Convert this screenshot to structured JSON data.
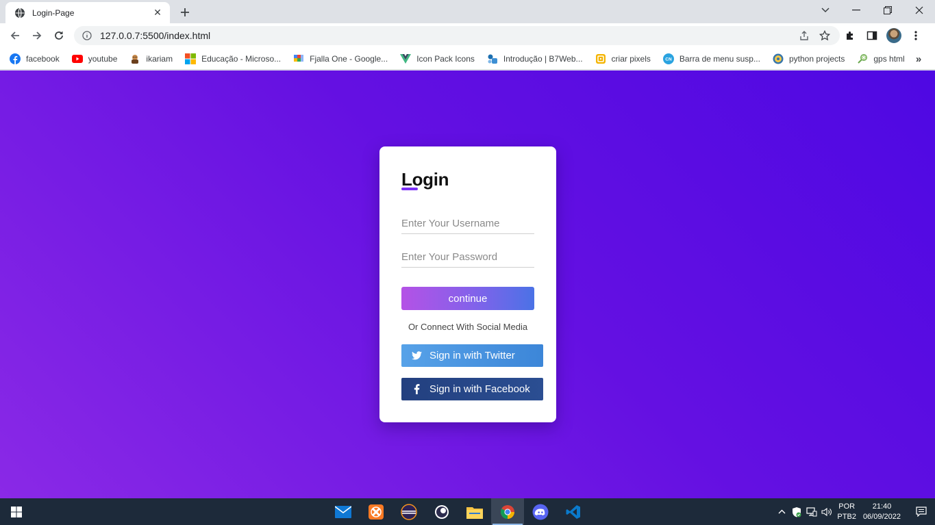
{
  "browser": {
    "tab": {
      "title": "Login-Page",
      "favicon": "globe-icon"
    },
    "address_bar": {
      "url": "127.0.0.7:5500/index.html"
    },
    "bookmarks": [
      {
        "label": "facebook",
        "icon": "facebook-icon",
        "color": "#1877f2"
      },
      {
        "label": "youtube",
        "icon": "youtube-icon",
        "color": "#ff0000"
      },
      {
        "label": "ikariam",
        "icon": "ikariam-icon",
        "color": "#8a5a2b"
      },
      {
        "label": "Educação - Microso...",
        "icon": "microsoft-icon",
        "color": "#f25022"
      },
      {
        "label": "Fjalla One - Google...",
        "icon": "google-fonts-icon",
        "color": "#4285f4"
      },
      {
        "label": "Icon Pack Icons",
        "icon": "vue-icon",
        "color": "#41b883"
      },
      {
        "label": "Introdução | B7Web...",
        "icon": "b7web-icon",
        "color": "#1c6fb0"
      },
      {
        "label": "criar pixels",
        "icon": "pixel-icon",
        "color": "#f4b400"
      },
      {
        "label": "Barra de menu susp...",
        "icon": "cn-icon",
        "color": "#2aa3e0"
      },
      {
        "label": "python projects",
        "icon": "python-icon",
        "color": "#f7c948"
      },
      {
        "label": "gps html",
        "icon": "gps-icon",
        "color": "#6aa84f"
      }
    ]
  },
  "login": {
    "title": "Login",
    "username_placeholder": "Enter Your Username",
    "password_placeholder": "Enter Your Password",
    "continue_label": "continue",
    "social_text": "Or Connect With Social Media",
    "twitter_label": "Sign in with Twitter",
    "facebook_label": "Sign in with Facebook"
  },
  "taskbar": {
    "apps": [
      "mail-icon",
      "xampp-icon",
      "eclipse-icon",
      "obs-icon",
      "file-explorer-icon",
      "chrome-icon",
      "discord-icon",
      "vscode-icon"
    ],
    "active_app": "chrome-icon",
    "language_line1": "POR",
    "language_line2": "PTB2",
    "time": "21:40",
    "date": "06/09/2022"
  },
  "colors": {
    "page_gradient_start": "#8a29e6",
    "page_gradient_end": "#4e08e3",
    "accent": "#7b2ff7",
    "twitter": "#57a2e8",
    "facebook": "#23407f"
  }
}
